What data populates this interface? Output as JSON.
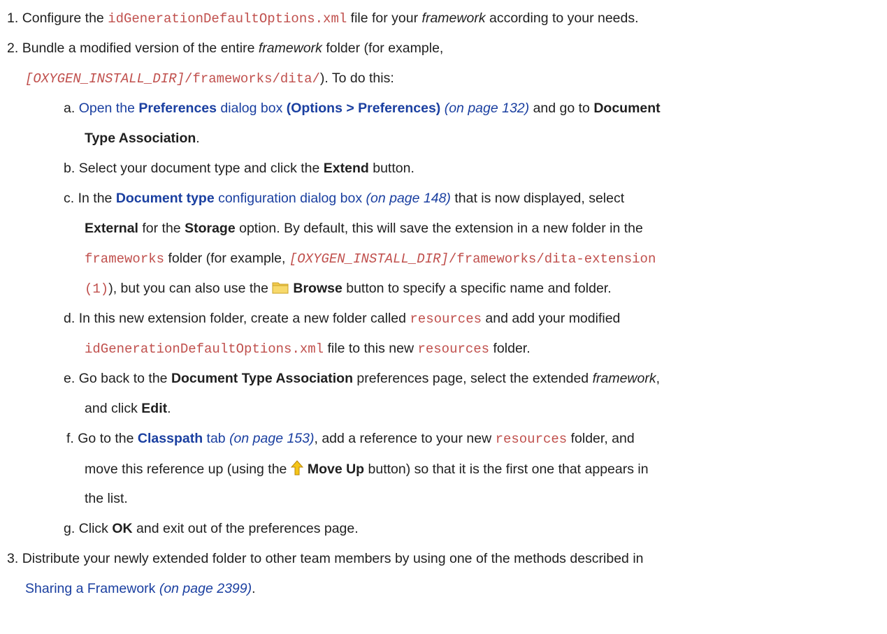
{
  "colors": {
    "text": "#1f1f1f",
    "code": "#c0504d",
    "link": "#1a3fa0"
  },
  "step1": {
    "num": "1.",
    "t1": "Configure the ",
    "code1": "idGenerationDefaultOptions.xml",
    "t2": " file for your ",
    "em1": "framework",
    "t3": " according to your needs."
  },
  "step2": {
    "num": "2.",
    "t1": "Bundle a modified version of the entire ",
    "em1": "framework",
    "t2": " folder (for example,",
    "var1": "[OXYGEN_INSTALL_DIR]",
    "code1": "/frameworks/dita/",
    "t3": "). To do this:",
    "a": {
      "label": "a.",
      "link1": "Open the ",
      "link_bold": "Preferences",
      "link2": " dialog box ",
      "link_bold2": "(Options > Preferences)",
      "page": "(on page 132)",
      "t1": " and go to ",
      "b1": "Document",
      "b2": "Type Association",
      "t2": "."
    },
    "b": {
      "label": "b.",
      "t1": "Select your document type and click the ",
      "b1": "Extend",
      "t2": " button."
    },
    "c": {
      "label": "c.",
      "t1": "In the ",
      "link_bold": "Document type",
      "link1": " configuration dialog box",
      "page": "(on page 148)",
      "t2": " that is now displayed, select",
      "b1": "External",
      "t3": " for the ",
      "b2": "Storage",
      "t4": " option. By default, this will save the extension in a new folder in the",
      "code1": "frameworks",
      "t5": " folder (for example, ",
      "var1": "[OXYGEN_INSTALL_DIR]",
      "code2": "/frameworks/dita-extension",
      "code3": "(1)",
      "t6": "), but you can also use the ",
      "icon": "folder-icon",
      "b3": "Browse",
      "t7": " button to specify a specific name and folder."
    },
    "d": {
      "label": "d.",
      "t1": "In this new extension folder, create a new folder called ",
      "code1": "resources",
      "t2": " and add your modified",
      "code2": "idGenerationDefaultOptions.xml",
      "t3": " file to this new ",
      "code3": "resources",
      "t4": " folder."
    },
    "e": {
      "label": "e.",
      "t1": "Go back to the ",
      "b1": "Document Type Association",
      "t2": " preferences page, select the extended ",
      "em1": "framework",
      "t3": ",",
      "t4": "and click ",
      "b2": "Edit",
      "t5": "."
    },
    "f": {
      "label": "f.",
      "t1": "Go to the ",
      "link_bold": "Classpath",
      "link1": " tab",
      "page": "(on page 153)",
      "t2": ", add a reference to your new ",
      "code1": "resources",
      "t3": " folder, and",
      "t4": "move this reference up (using the ",
      "icon": "move-up-arrow-icon",
      "b1": "Move Up",
      "t5": " button) so that it is the first one that appears in",
      "t6": "the list."
    },
    "g": {
      "label": "g.",
      "t1": "Click ",
      "b1": "OK",
      "t2": " and exit out of the preferences page."
    }
  },
  "step3": {
    "num": "3.",
    "t1": "Distribute your newly extended folder to other team members by using one of the methods described in",
    "link1": "Sharing a Framework",
    "page": "(on page 2399)",
    "t2": "."
  }
}
